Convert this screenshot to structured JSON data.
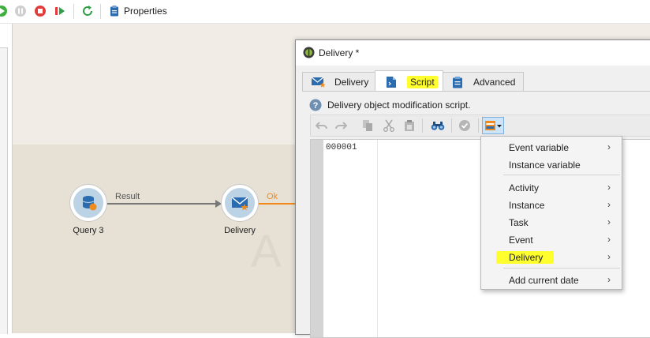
{
  "toolbar": {
    "properties_label": "Properties",
    "icons": [
      "start-icon",
      "pause-icon",
      "stop-icon",
      "resume-icon",
      "refresh-icon",
      "properties-icon"
    ]
  },
  "workflow": {
    "canvas_watermark": "A",
    "nodes": [
      {
        "label": "Query 3",
        "icon": "database-icon"
      },
      {
        "label": "Delivery",
        "icon": "envelope-star-icon"
      }
    ],
    "transitions": [
      {
        "label": "Result"
      },
      {
        "label": "Ok"
      }
    ]
  },
  "dialog": {
    "title": "Delivery *",
    "tabs": [
      {
        "label": "Delivery",
        "icon": "envelope-star-icon",
        "active": false
      },
      {
        "label": "Script",
        "icon": "script-document-icon",
        "active": true
      },
      {
        "label": "Advanced",
        "icon": "clipboard-icon",
        "active": false
      }
    ],
    "script_info": "Delivery object modification script.",
    "editor": {
      "line_numbers": [
        "000001"
      ],
      "toolbar_icons": [
        "undo-icon",
        "redo-icon",
        "copy-icon",
        "cut-icon",
        "paste-icon",
        "find-icon",
        "validate-icon",
        "insert-field-icon"
      ]
    }
  },
  "context_menu": {
    "items": [
      {
        "label": "Event variable",
        "submenu": true
      },
      {
        "label": "Instance variable",
        "submenu": false
      },
      {
        "label": "Activity",
        "submenu": true
      },
      {
        "label": "Instance",
        "submenu": true
      },
      {
        "label": "Task",
        "submenu": true
      },
      {
        "label": "Event",
        "submenu": true
      },
      {
        "label": "Delivery",
        "submenu": true,
        "highlighted": true
      },
      {
        "label": "Add current date",
        "submenu": true
      }
    ],
    "arrow_glyph": "›"
  },
  "colors": {
    "highlight": "#ffff2e",
    "node_fill": "#bcd3e6",
    "ok_transition": "#f08a1c",
    "accent_blue": "#2b6cb0"
  }
}
